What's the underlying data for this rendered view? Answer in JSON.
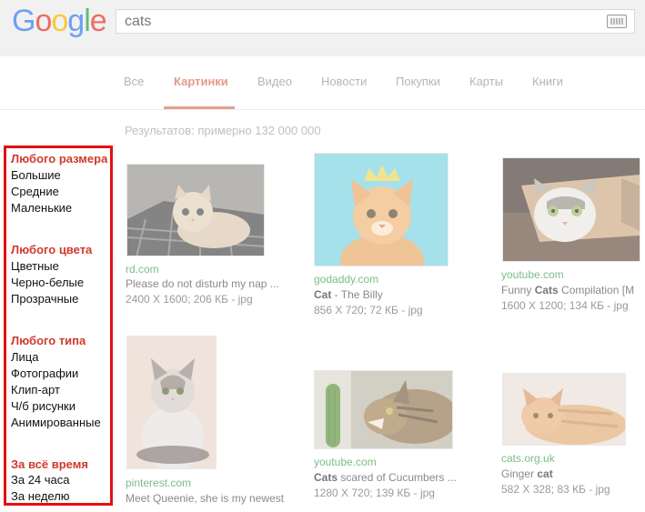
{
  "header": {
    "logo": [
      "G",
      "o",
      "o",
      "g",
      "l",
      "e"
    ],
    "logo_colors": [
      "#4285f4",
      "#ea4335",
      "#fbbc05",
      "#4285f4",
      "#34a853",
      "#ea4335"
    ],
    "search_value": "cats",
    "keyboard_icon": "keyboard-icon"
  },
  "tabs": [
    {
      "label": "Все"
    },
    {
      "label": "Картинки",
      "active": true
    },
    {
      "label": "Видео"
    },
    {
      "label": "Новости"
    },
    {
      "label": "Покупки"
    },
    {
      "label": "Карты"
    },
    {
      "label": "Книги"
    }
  ],
  "results_count": "Результатов: примерно 132 000 000",
  "sidebar": {
    "size_head": "Любого размера",
    "size_items": [
      "Большие",
      "Средние",
      "Маленькие"
    ],
    "color_head": "Любого цвета",
    "color_items": [
      "Цветные",
      "Черно-белые",
      "Прозрачные"
    ],
    "type_head": "Любого типа",
    "type_items": [
      "Лица",
      "Фотографии",
      "Клип-арт",
      "Ч/б рисунки",
      "Анимированные"
    ],
    "time_head": "За всё время",
    "time_items": [
      "За 24 часа",
      "За неделю"
    ]
  },
  "results": [
    {
      "domain": "rd.com",
      "title_pre": "Please do not disturb my nap ...",
      "title_bold": "",
      "title_post": "",
      "meta": "2400 X 1600; 206 КБ - jpg"
    },
    {
      "domain": "godaddy.com",
      "title_pre": "",
      "title_bold": "Cat",
      "title_post": " - The Billy",
      "meta": "856 X 720; 72 КБ - jpg"
    },
    {
      "domain": "youtube.com",
      "title_pre": "Funny ",
      "title_bold": "Cats",
      "title_post": " Compilation [M",
      "meta": "1600 X 1200; 134 КБ - jpg"
    },
    {
      "domain": "pinterest.com",
      "title_pre": "Meet Queenie, she is my newest",
      "title_bold": "",
      "title_post": "",
      "meta": ""
    },
    {
      "domain": "youtube.com",
      "title_pre": "",
      "title_bold": "Cats",
      "title_post": " scared of Cucumbers ...",
      "meta": "1280 X 720; 139 КБ - jpg"
    },
    {
      "domain": "cats.org.uk",
      "title_pre": "Ginger ",
      "title_bold": "cat",
      "title_post": "",
      "meta": "582 X 328; 83 КБ - jpg"
    }
  ]
}
